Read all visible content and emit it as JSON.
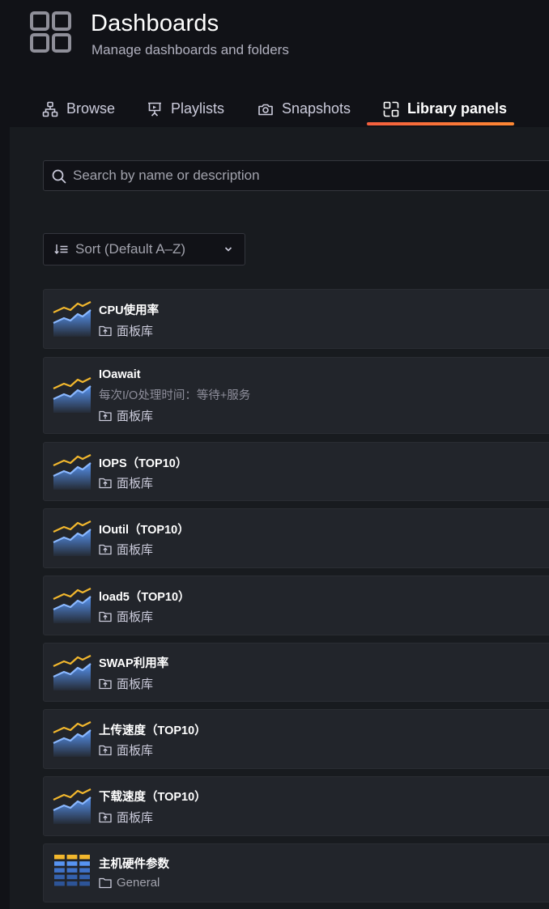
{
  "header": {
    "title": "Dashboards",
    "subtitle": "Manage dashboards and folders",
    "icon": "dashboards-grid-icon"
  },
  "tabs": [
    {
      "label": "Browse",
      "icon": "sitemap-icon",
      "active": false
    },
    {
      "label": "Playlists",
      "icon": "presentation-icon",
      "active": false
    },
    {
      "label": "Snapshots",
      "icon": "camera-icon",
      "active": false
    },
    {
      "label": "Library panels",
      "icon": "library-panel-icon",
      "active": true
    }
  ],
  "search": {
    "placeholder": "Search by name or description",
    "value": ""
  },
  "sort": {
    "label": "Sort (Default A–Z)"
  },
  "panels": [
    {
      "title": "CPU使用率",
      "description": "",
      "folder": "面板库",
      "type": "timeseries"
    },
    {
      "title": "IOawait",
      "description": "每次I/O处理时间：等待+服务",
      "folder": "面板库",
      "type": "timeseries"
    },
    {
      "title": "IOPS（TOP10）",
      "description": "",
      "folder": "面板库",
      "type": "timeseries"
    },
    {
      "title": "IOutil（TOP10）",
      "description": "",
      "folder": "面板库",
      "type": "timeseries"
    },
    {
      "title": "load5（TOP10）",
      "description": "",
      "folder": "面板库",
      "type": "timeseries"
    },
    {
      "title": "SWAP利用率",
      "description": "",
      "folder": "面板库",
      "type": "timeseries"
    },
    {
      "title": "上传速度（TOP10）",
      "description": "",
      "folder": "面板库",
      "type": "timeseries"
    },
    {
      "title": "下载速度（TOP10）",
      "description": "",
      "folder": "面板库",
      "type": "timeseries"
    },
    {
      "title": "主机硬件参数",
      "description": "",
      "folder": "General",
      "type": "table"
    }
  ],
  "colors": {
    "accent": "#f55f3e",
    "series_yellow": "#f2b72d",
    "series_blue": "#5794f2"
  }
}
